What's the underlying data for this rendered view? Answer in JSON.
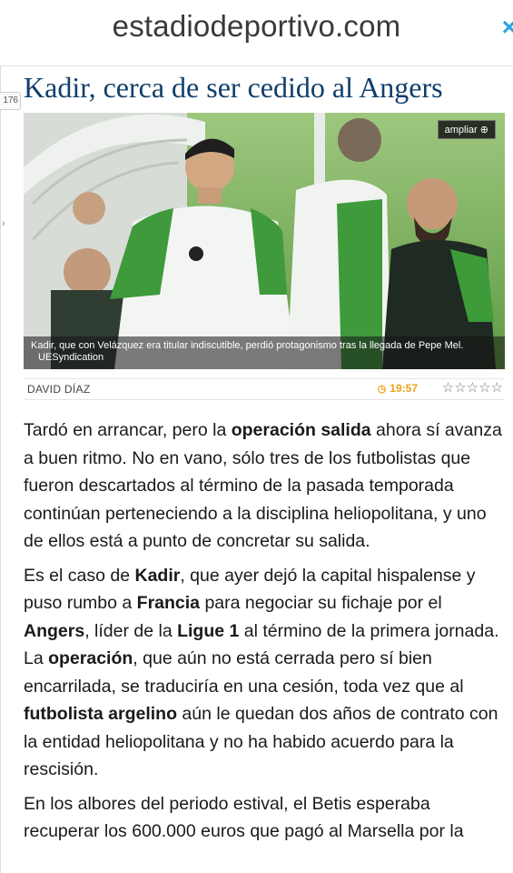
{
  "site": {
    "name": "estadiodeportivo.com",
    "close_icon": "×"
  },
  "sidebar": {
    "counter": "176"
  },
  "article": {
    "headline": "Kadir, cerca de ser cedido al Angers",
    "image": {
      "zoom_label": "ampliar",
      "caption": "Kadir, que con Velázquez era titular indiscutible, perdió protagonismo tras la llegada de Pepe Mel.",
      "credit": "UESyndication"
    },
    "author": "DAVID DÍAZ",
    "time": "19:57",
    "rating": "☆☆☆☆☆",
    "paragraphs": [
      [
        {
          "t": "Tardó en arrancar, pero la "
        },
        {
          "t": "operación salida",
          "b": true
        },
        {
          "t": " ahora sí avanza a buen ritmo. No en vano, sólo tres de los futbolistas que fueron descartados al término de la pasada temporada continúan perteneciendo a la disciplina heliopolitana, y uno de ellos está a punto de concretar su salida."
        }
      ],
      [
        {
          "t": "Es el caso de "
        },
        {
          "t": "Kadir",
          "b": true
        },
        {
          "t": ", que ayer dejó la capital hispalense y puso rumbo a "
        },
        {
          "t": "Francia",
          "b": true
        },
        {
          "t": " para negociar su fichaje por el "
        },
        {
          "t": "Angers",
          "b": true
        },
        {
          "t": ", líder de la "
        },
        {
          "t": "Ligue 1",
          "b": true
        },
        {
          "t": " al término de la primera jornada. La "
        },
        {
          "t": "operación",
          "b": true
        },
        {
          "t": ", que aún no está cerrada pero sí bien encarrilada, se traduciría en una cesión, toda vez que al "
        },
        {
          "t": "futbolista argelino",
          "b": true
        },
        {
          "t": " aún le quedan dos años de contrato con la entidad heliopolitana y no ha habido acuerdo para la rescisión."
        }
      ],
      [
        {
          "t": "En los albores del periodo estival, el Betis esperaba recuperar los 600.000 euros que pagó al Marsella por la"
        }
      ]
    ]
  },
  "colors": {
    "headline": "#0f3f6b",
    "time": "#e8a316",
    "close": "#2aa6e0"
  }
}
